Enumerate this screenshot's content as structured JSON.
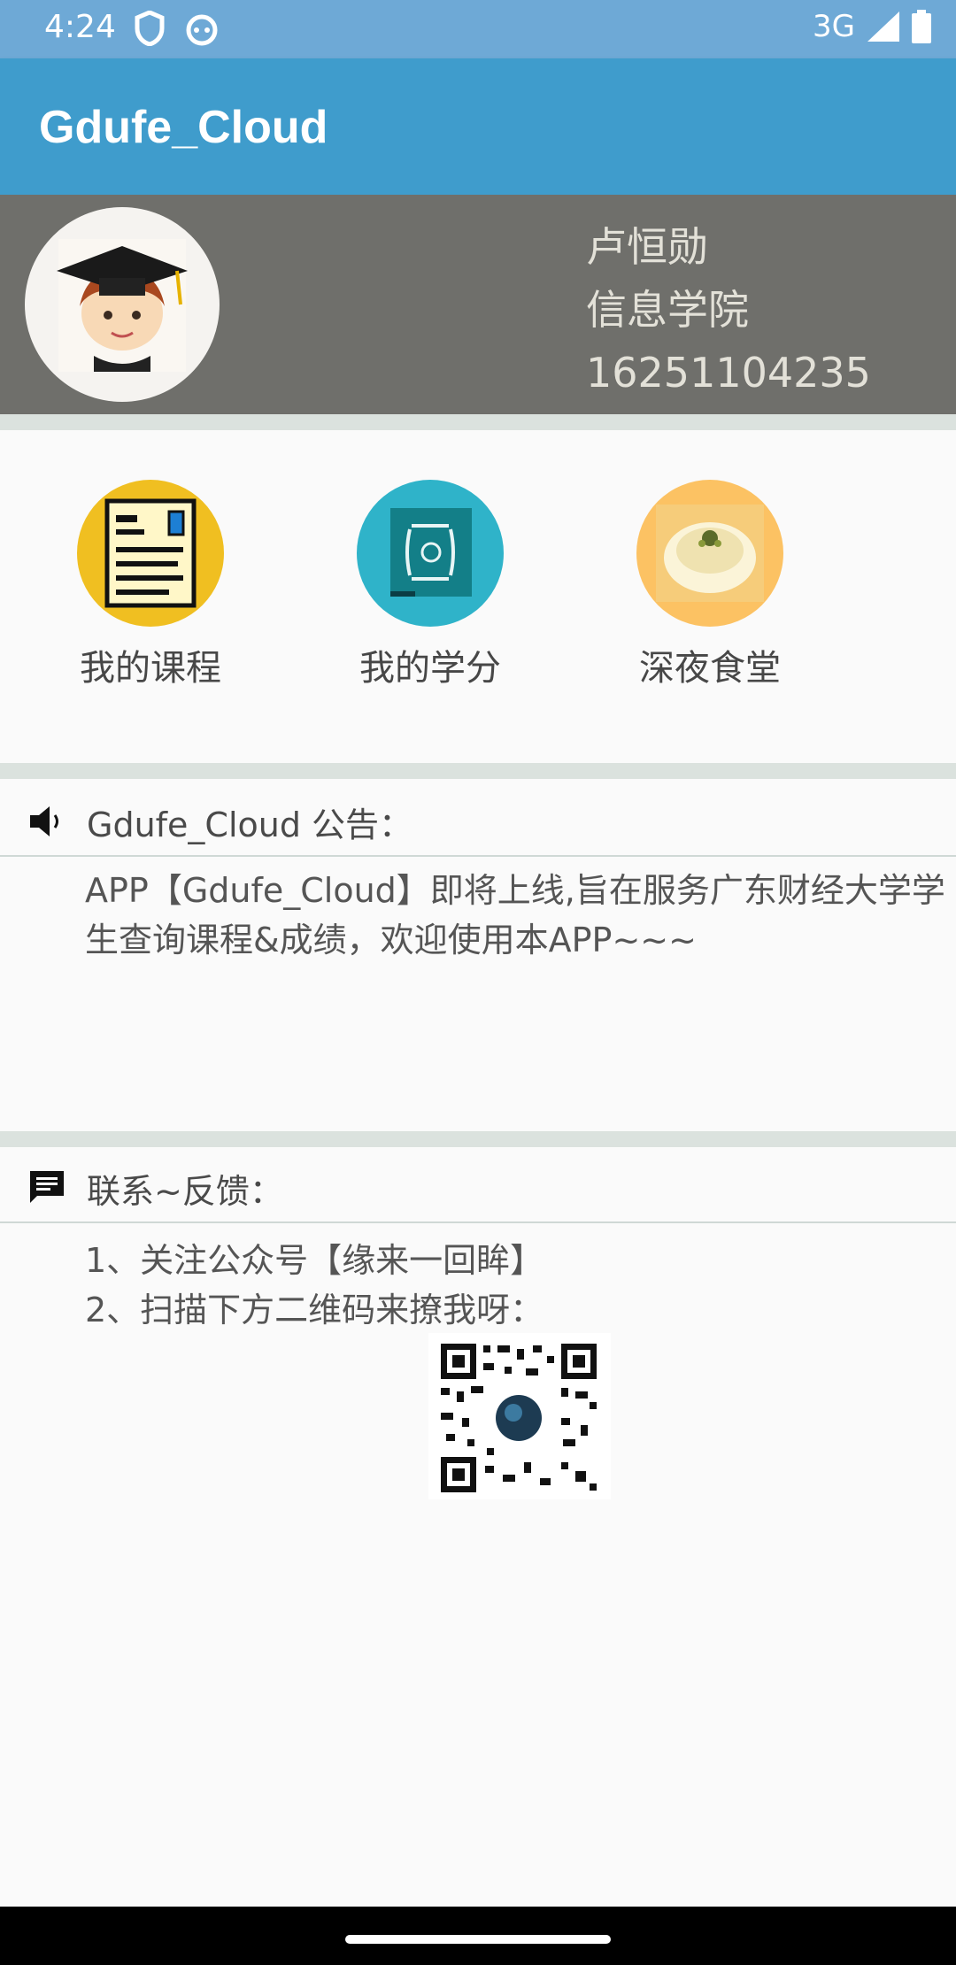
{
  "status_bar": {
    "time": "4:24",
    "network": "3G",
    "icons": [
      "shield-icon",
      "android-face-icon",
      "signal-icon",
      "battery-icon"
    ]
  },
  "app_bar": {
    "title": "Gdufe_Cloud",
    "color": "#3f9ccc"
  },
  "profile": {
    "name": "卢恒勋",
    "college": "信息学院",
    "student_id": "16251104235",
    "avatar_icon": "graduate-boy-icon"
  },
  "menu": [
    {
      "label": "我的课程",
      "icon": "course-document-icon",
      "color": "#f0bf21"
    },
    {
      "label": "我的学分",
      "icon": "credit-book-icon",
      "color": "#2fb3c9"
    },
    {
      "label": "深夜食堂",
      "icon": "food-dumpling-icon",
      "color": "#fcc263"
    }
  ],
  "notice": {
    "title": "Gdufe_Cloud 公告：",
    "icon": "speaker-icon",
    "line1": "APP【Gdufe_Cloud】即将上线,旨在服务广东财经大学学",
    "line2": "生查询课程&成绩，欢迎使用本APP~~~"
  },
  "contact": {
    "title": "联系~反馈：",
    "icon": "chat-message-icon",
    "line1": "1、关注公众号【缘来一回眸】",
    "line2": "2、扫描下方二维码来撩我呀：",
    "qr_icon": "qr-code-icon"
  }
}
